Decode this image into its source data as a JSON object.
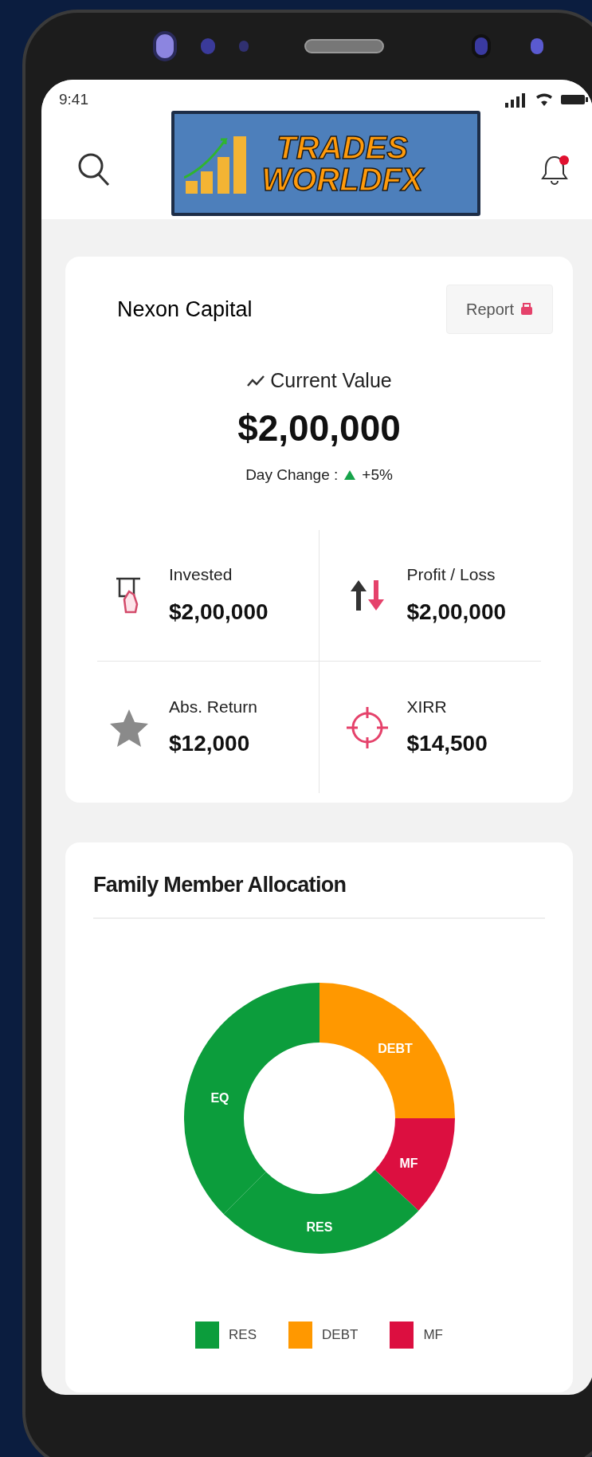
{
  "status_bar": {
    "time": "9:41"
  },
  "header": {
    "logo": {
      "line_1": "TRADES",
      "line_2": "WORLDFX"
    },
    "notification_dot": true
  },
  "summary_card": {
    "title": "Nexon Capital",
    "report_button": "Report",
    "current_value_label": "Current Value",
    "current_value": "$2,00,000",
    "day_change_label": "Day Change :",
    "day_change": "+5%",
    "stats": [
      {
        "kind": "invested",
        "label": "Invested",
        "value": "$2,00,000"
      },
      {
        "kind": "profit_loss",
        "label": "Profit / Loss",
        "value": "$2,00,000"
      },
      {
        "kind": "abs_return",
        "label": "Abs. Return",
        "value": "$12,000"
      },
      {
        "kind": "xirr",
        "label": "XIRR",
        "value": "$14,500"
      }
    ]
  },
  "allocation_card": {
    "title": "Family Member Allocation",
    "slices": [
      {
        "label": "DEBT",
        "color": "#ff9800"
      },
      {
        "label": "MF",
        "color": "#dc0f40"
      },
      {
        "label": "RES",
        "color": "#0c9d3c"
      },
      {
        "label": "EQ",
        "color": "#0c9d3c"
      }
    ],
    "legend": [
      {
        "label": "RES",
        "color": "#0c9d3c"
      },
      {
        "label": "DEBT",
        "color": "#ff9800"
      },
      {
        "label": "MF",
        "color": "#dc0f40"
      }
    ]
  }
}
